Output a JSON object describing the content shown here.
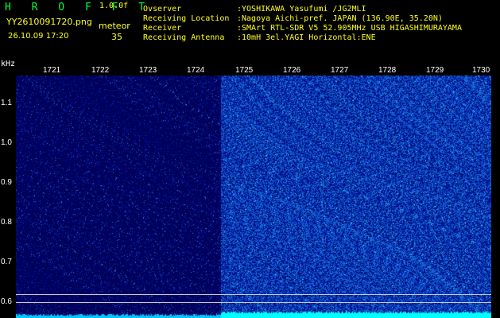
{
  "header": {
    "app_title": "H R O F F T",
    "version": "1.0.0f",
    "filename": "YY2610091720.png",
    "datetime": "26.10.09 17:20",
    "meteor_label": "meteor",
    "meteor_count": "35"
  },
  "info": [
    {
      "label": "Ovserver",
      "value": ":YOSHIKAWA Yasufumi /JG2MLI"
    },
    {
      "label": "Receiving Location",
      "value": ":Nagoya Aichi-pref. JAPAN (136.90E, 35.20N)"
    },
    {
      "label": "Receiver",
      "value": ":SMArt RTL-SDR V5 52.905MHz USB HIGASHIMURAYAMA"
    },
    {
      "label": "Receiving Antenna",
      "value": ":10mH 3el.YAGI Horizontal:ENE"
    }
  ],
  "axis": {
    "unit": "kHz",
    "y_ticks": [
      "1.1",
      "1.0",
      "0.9",
      "0.8",
      "0.7",
      "0.6"
    ],
    "x_ticks": [
      "1721",
      "1722",
      "1723",
      "1724",
      "1725",
      "1726",
      "1727",
      "1728",
      "1729",
      "1730"
    ]
  },
  "colors": {
    "background": "#000000",
    "text_yellow": "#ffff20",
    "title_green": "#00ff40",
    "noise_dim": "#00007a",
    "noise_bright": "#1a5ac8",
    "baseline_cyan": "#00ffff"
  }
}
